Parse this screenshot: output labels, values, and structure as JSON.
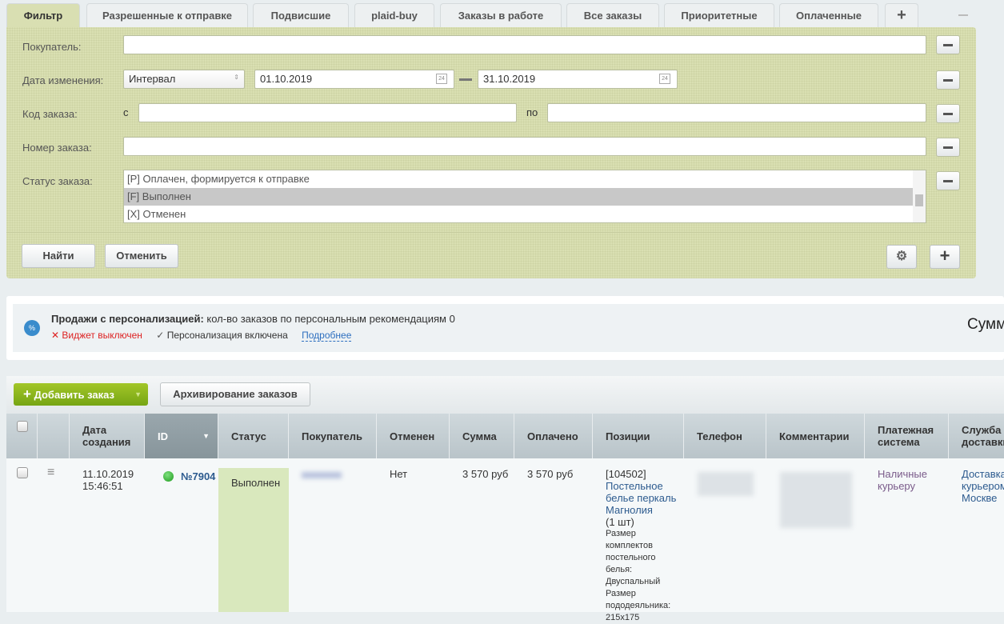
{
  "tabs": [
    "Фильтр",
    "Разрешенные к отправке",
    "Подвисшие",
    "plaid-buy",
    "Заказы в работе",
    "Все заказы",
    "Приоритетные",
    "Оплаченные"
  ],
  "add_tab": "+",
  "filter": {
    "buyer_label": "Покупатель:",
    "buyer_value": "",
    "date_label": "Дата изменения:",
    "date_mode": "Интервал",
    "date_from": "01.10.2019",
    "date_to": "31.10.2019",
    "cal_day": "24",
    "code_label": "Код заказа:",
    "code_from_label": "с",
    "code_to_label": "по",
    "number_label": "Номер заказа:",
    "status_label": "Статус заказа:",
    "status_options": [
      "[P] Оплачен, формируется к отправке",
      "[F] Выполнен",
      "[X] Отменен"
    ],
    "find": "Найти",
    "cancel": "Отменить"
  },
  "personalization": {
    "title": "Продажи с персонализацией:",
    "text": "кол-во заказов по персональным рекомендациям 0",
    "widget": "Виджет выключен",
    "enabled": "Персонализация включена",
    "more": "Подробнее",
    "sum": "Сумм"
  },
  "toolbar": {
    "add": "Добавить заказ",
    "archive": "Архивирование заказов"
  },
  "columns": [
    "Дата создания",
    "ID",
    "Статус",
    "Покупатель",
    "Отменен",
    "Сумма",
    "Оплачено",
    "Позиции",
    "Телефон",
    "Комментарии",
    "Платежная система",
    "Служба доставки"
  ],
  "row": {
    "date": "11.10.2019",
    "time": "15:46:51",
    "id": "№7904",
    "status": "Выполнен",
    "cancelled": "Нет",
    "sum": "3 570 руб",
    "paid": "3 570 руб",
    "pos_code": "[104502]",
    "pos_name": "Постельное белье перкаль Магнолия",
    "pos_qty": "(1 шт)",
    "pos_props": "Размер комплектов постельного белья: Двуспальный Размер пододеяльника: 215x175",
    "payment": "Наличные курьеру",
    "delivery": "Доставка курьером Москве"
  }
}
